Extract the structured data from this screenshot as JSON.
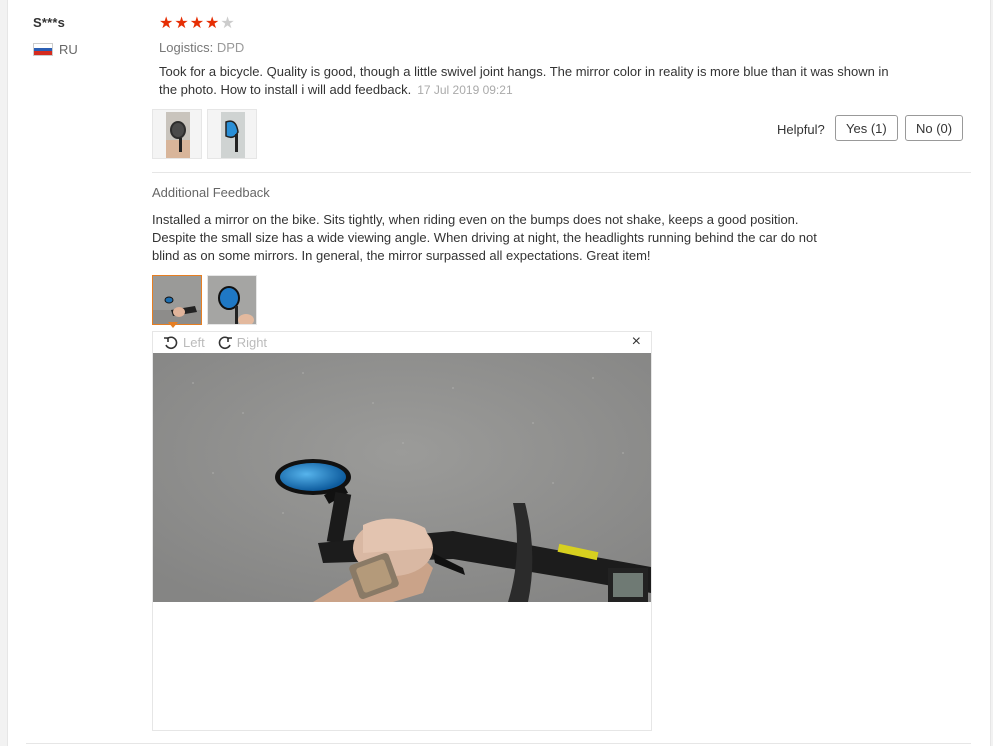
{
  "review": {
    "user": "S***s",
    "country": "RU",
    "rating": 4,
    "max_rating": 5,
    "logistics_label": "Logistics:",
    "logistics_value": "DPD",
    "text": "Took for a bicycle. Quality is good, though a little swivel joint hangs. The mirror color in reality is more blue than it was shown in the photo. How to install i will add feedback.",
    "date": "17 Jul 2019 09:21",
    "helpful_label": "Helpful?",
    "yes_label": "Yes (1)",
    "no_label": "No (0)"
  },
  "additional": {
    "title": "Additional Feedback",
    "text": "Installed a mirror on the bike. Sits tightly, when riding even on the bumps does not shake, keeps a good position. Despite the small size has a wide viewing angle. When driving at night, the headlights running behind the car do not blind as on some mirrors. In general, the mirror surpassed all expectations. Great item!"
  },
  "viewer": {
    "rotate_left_label": "Left",
    "rotate_right_label": "Right",
    "close_glyph": "×"
  },
  "colors": {
    "star": "#e62e04",
    "selected_border": "#e67e22",
    "mirror_blue": "#2a8fd6"
  }
}
